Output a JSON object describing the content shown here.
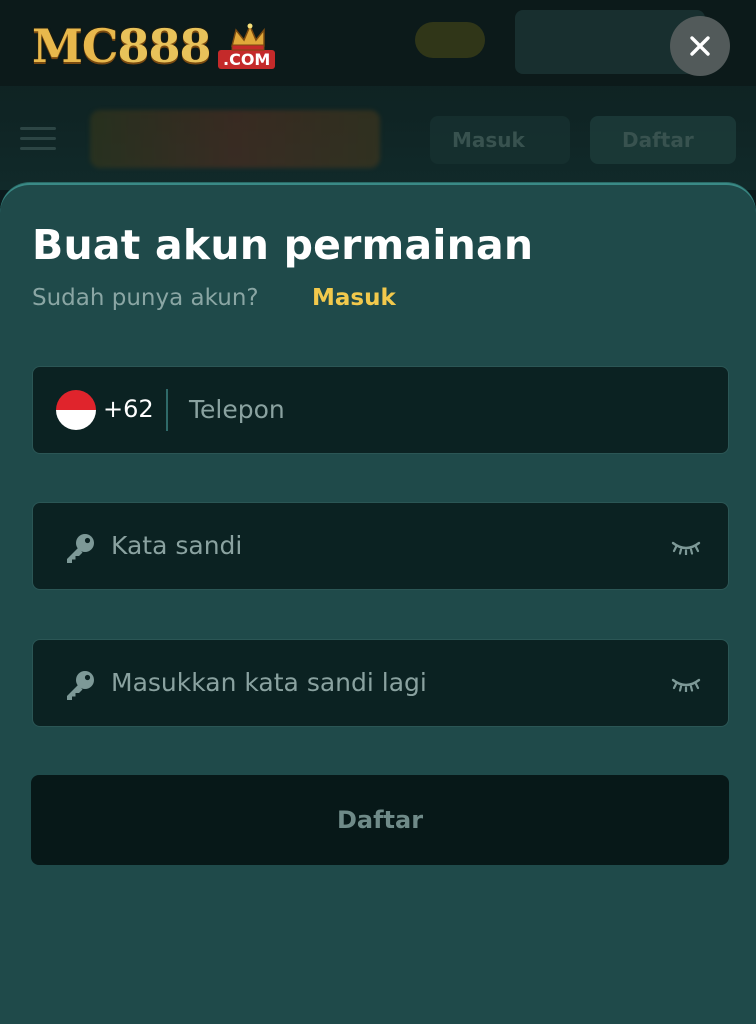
{
  "brand": {
    "logo_main": "MC",
    "logo_number": "888",
    "logo_suffix": ".COM",
    "gold": "#e8b84c",
    "red": "#c42a2a"
  },
  "background": {
    "login_label": "Masuk",
    "register_label": "Daftar"
  },
  "close": {
    "icon": "close-icon"
  },
  "form": {
    "title": "Buat akun permainan",
    "subtitle": "Sudah punya akun?",
    "login_link": "Masuk",
    "phone": {
      "country_code": "+62",
      "placeholder": "Telepon",
      "flag": "indonesia-flag-icon"
    },
    "password": {
      "placeholder": "Kata sandi",
      "icon": "key-icon",
      "toggle_icon": "eye-closed-icon"
    },
    "confirm_password": {
      "placeholder": "Masukkan kata sandi lagi",
      "icon": "key-icon",
      "toggle_icon": "eye-closed-icon"
    },
    "submit_label": "Daftar"
  },
  "colors": {
    "sheet": "#1f4a4a",
    "accent": "#f2c94c",
    "input_bg": "#0b2222"
  }
}
